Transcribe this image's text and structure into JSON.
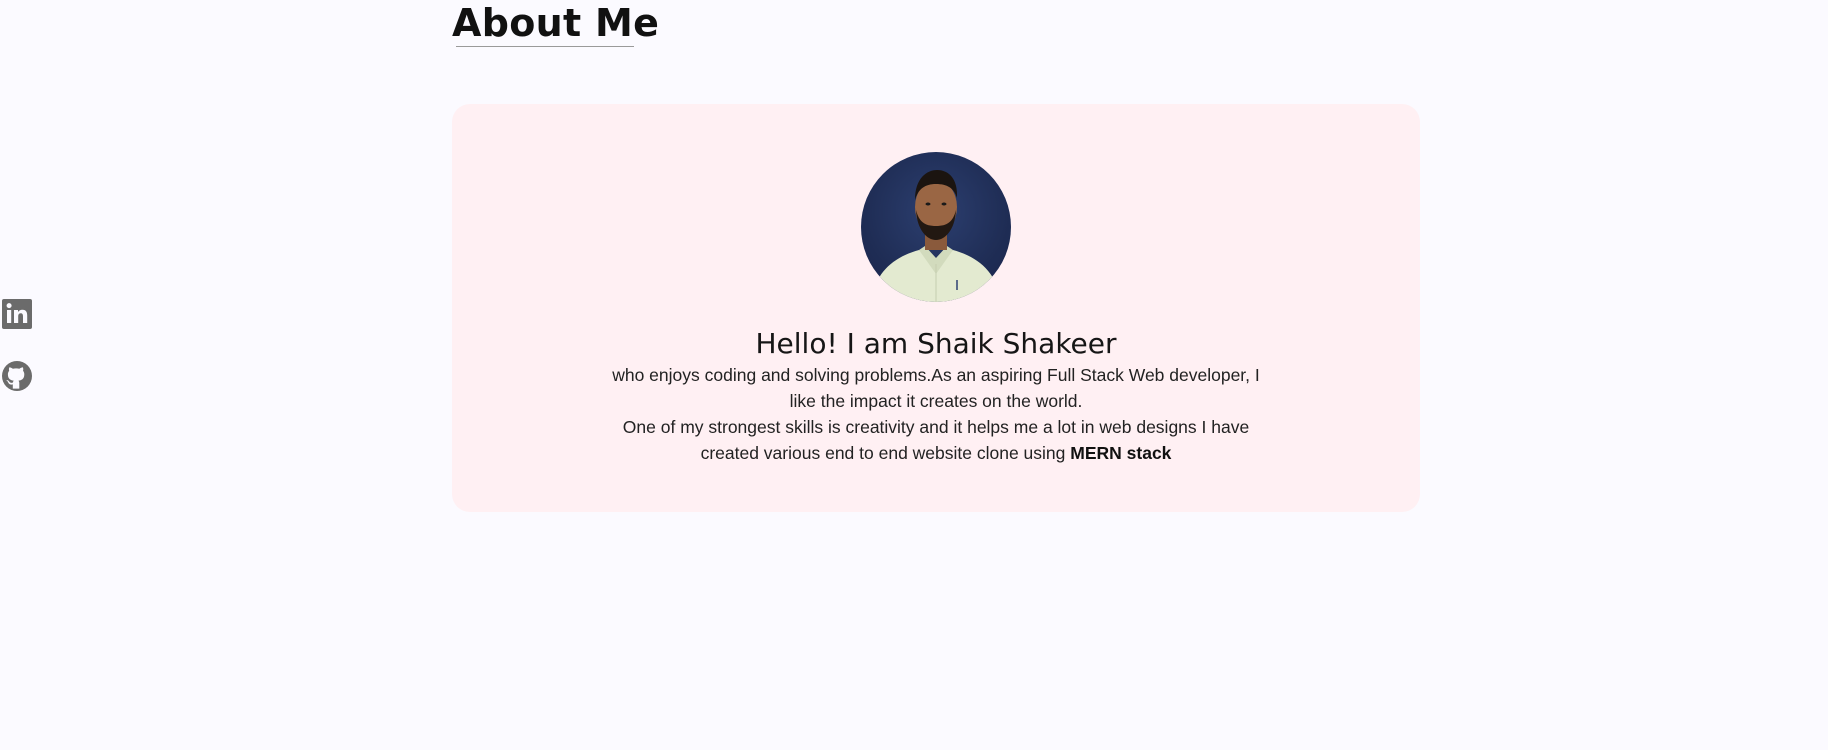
{
  "social": {
    "items": [
      {
        "name": "linkedin-icon"
      },
      {
        "name": "github-icon"
      }
    ],
    "icon_color": "#6b6b6b"
  },
  "section": {
    "title": "About Me"
  },
  "about": {
    "greeting": "Hello! I am Shaik Shakeer",
    "bio_line1": "who enjoys coding and solving problems.As an aspiring Full Stack Web developer, I like the impact it creates on the world.",
    "bio_line2_prefix": "One of my strongest skills is creativity and it helps me a lot in web designs I have created various end to end website clone using ",
    "bio_line2_emphasis": "MERN stack",
    "card_color": "#fff0f3",
    "avatar_bg_color": "#1f2d55"
  }
}
